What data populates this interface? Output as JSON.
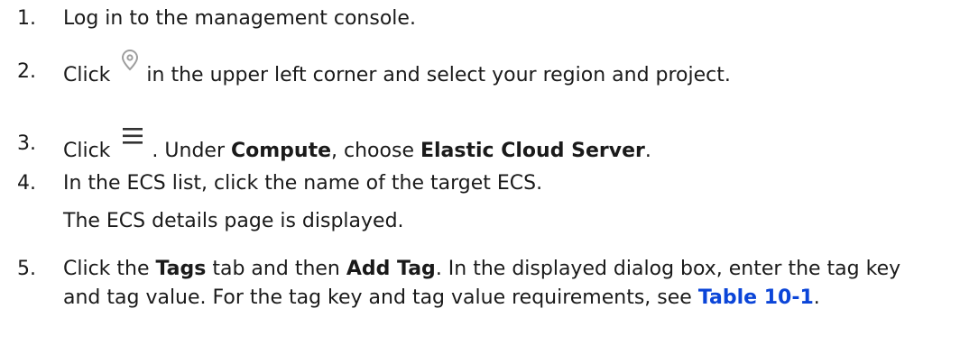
{
  "steps": [
    {
      "num": "1.",
      "text": "Log in to the management console."
    },
    {
      "num": "2.",
      "pre": "Click",
      "icon": "location-pin-icon",
      "post": "in the upper left corner and select your region and project."
    },
    {
      "num": "3.",
      "pre": "Click",
      "icon": "menu-hamburger-icon",
      "mid1": ". Under ",
      "bold1": "Compute",
      "mid2": ", choose ",
      "bold2": "Elastic Cloud Server",
      "end": "."
    },
    {
      "num": "4.",
      "text": "In the ECS list, click the name of the target ECS.",
      "sub": "The ECS details page is displayed."
    },
    {
      "num": "5.",
      "t1": "Click the ",
      "b1": "Tags",
      "t2": " tab and then ",
      "b2": "Add Tag",
      "t3": ". In the displayed dialog box, enter the tag key and tag value. For the tag key and tag value requirements, see ",
      "link": "Table 10-1",
      "t4": "."
    }
  ],
  "colors": {
    "text": "#1a1a1a",
    "link": "#0b45d8",
    "icon": "#9e9e9e"
  }
}
